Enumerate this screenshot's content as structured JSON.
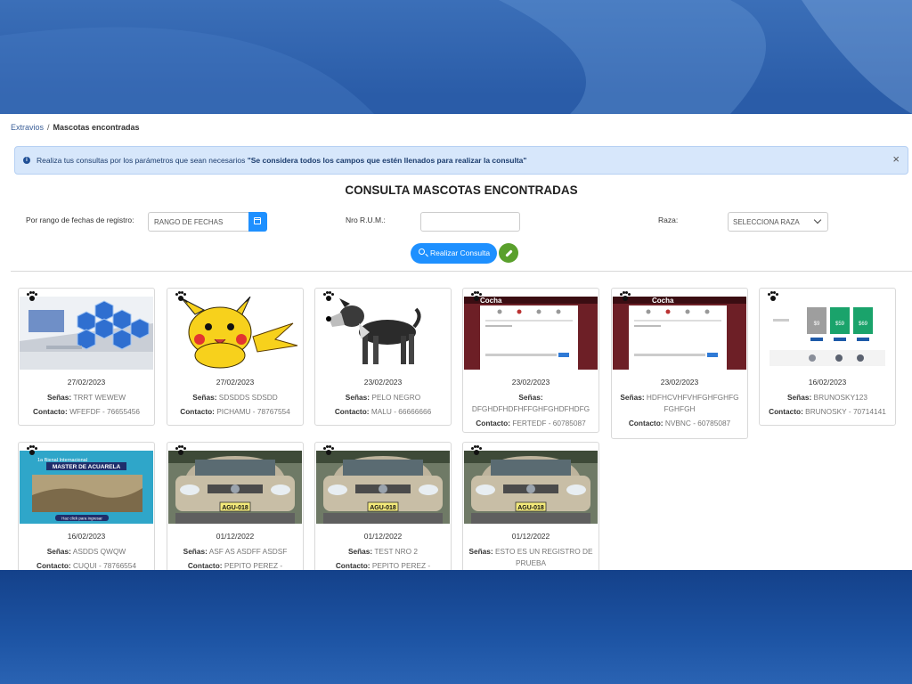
{
  "breadcrumb": {
    "parent": "Extravios",
    "sep": "/",
    "current": "Mascotas encontradas"
  },
  "alert": {
    "text": "Realiza tus consultas por los parámetros que sean necesarios ",
    "bold": "\"Se considera todos los campos que estén llenados para realizar la consulta\"",
    "close": "×"
  },
  "form": {
    "title": "CONSULTA MASCOTAS ENCONTRADAS",
    "date_label": "Por rango de fechas de registro:",
    "date_placeholder": "RANGO DE FECHAS",
    "rum_label": "Nro R.U.M.:",
    "rum_value": "",
    "raza_label": "Raza:",
    "raza_value": "SELECCIONA RAZA",
    "query_button": "Realizar Consulta"
  },
  "labels": {
    "senas": "Señas:",
    "contacto": "Contacto:"
  },
  "cards": [
    {
      "date": "27/02/2023",
      "senas": "TRRT WEWEW",
      "contacto": "WFEFDF - 76655456"
    },
    {
      "date": "27/02/2023",
      "senas": "SDSDDS SDSDD",
      "contacto": "PICHAMU - 78767554"
    },
    {
      "date": "23/02/2023",
      "senas": "PELO NEGRO",
      "contacto": "MALU - 66666666"
    },
    {
      "date": "23/02/2023",
      "senas": "DFGHDFHDFHFFGHFGHDFHDFG",
      "contacto": "FERTEDF - 60785087"
    },
    {
      "date": "23/02/2023",
      "senas": "HDFHCVHFVHFGHFGHFG FGHFGH",
      "contacto": "NVBNC - 60785087"
    },
    {
      "date": "16/02/2023",
      "senas": "BRUNOSKY123",
      "contacto": "BRUNOSKY - 70714141"
    },
    {
      "date": "16/02/2023",
      "senas": "ASDDS QWQW",
      "contacto": "CUQUI - 78766554"
    },
    {
      "date": "01/12/2022",
      "senas": "ASF AS ASDFF ASDSF",
      "contacto": "PEPITO PEREZ -"
    },
    {
      "date": "01/12/2022",
      "senas": "TEST NRO 2",
      "contacto": "PEPITO PEREZ -"
    },
    {
      "date": "01/12/2022",
      "senas": "ESTO ES UN REGISTRO DE PRUEBA",
      "contacto": ""
    }
  ],
  "image_text": {
    "cocha": "Cocha",
    "acuarela_top": "1a Bienal Internacional",
    "acuarela_title": "MASTER DE ACUARELA",
    "acuarela_cta": "Haz click para ingresar",
    "plate": "AGU-018",
    "prices": [
      "$9",
      "$59",
      "$69"
    ]
  },
  "colors": {
    "primary": "#1e90ff",
    "success": "#5aa02c",
    "alert_bg": "#d7e7fb",
    "bg": "#2a5ca8"
  }
}
